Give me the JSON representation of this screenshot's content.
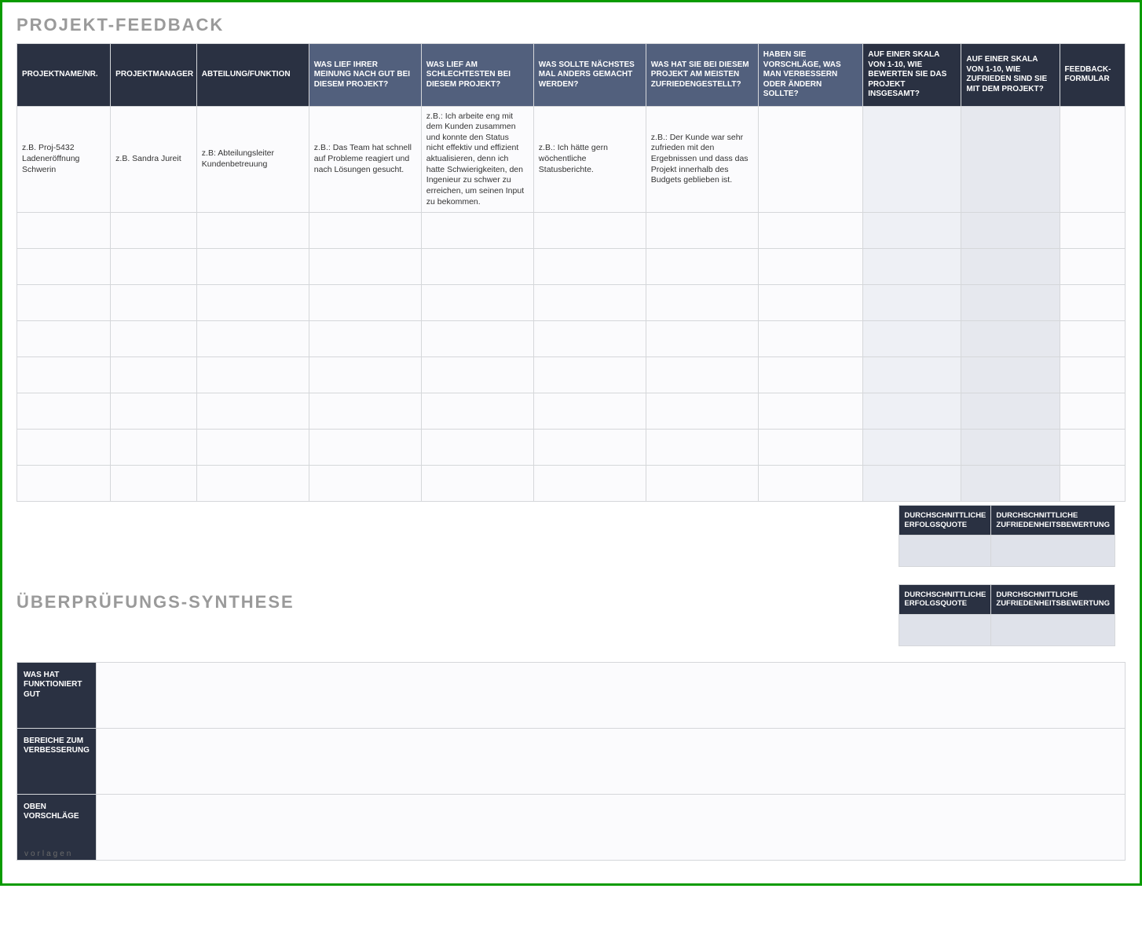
{
  "titles": {
    "feedback": "PROJEKT-FEEDBACK",
    "synthesis": "ÜBERPRÜFUNGS-SYNTHESE"
  },
  "headers": [
    "PROJEKTNAME/NR.",
    "PROJEKTMANAGER",
    "ABTEILUNG/FUNKTION",
    "WAS LIEF IHRER MEINUNG NACH GUT BEI DIESEM PROJEKT?",
    "WAS LIEF AM SCHLECHTESTEN BEI DIESEM PROJEKT?",
    "WAS SOLLTE NÄCHSTES MAL ANDERS GEMACHT WERDEN?",
    "WAS HAT SIE BEI DIESEM PROJEKT AM MEISTEN ZUFRIEDENGESTELLT?",
    "HABEN SIE VORSCHLÄGE, WAS MAN VERBESSERN ODER ÄNDERN SOLLTE?",
    "AUF EINER SKALA VON 1-10, WIE BEWERTEN SIE DAS PROJEKT INSGESAMT?",
    "AUF EINER SKALA VON 1-10, WIE ZUFRIEDEN SIND SIE MIT DEM PROJEKT?",
    "FEEDBACK-FORMULAR"
  ],
  "row0": {
    "c0": "z.B. Proj-5432 Ladeneröffnung Schwerin",
    "c1": "z.B. Sandra Jureit",
    "c2": "z.B: Abteilungsleiter Kundenbetreuung",
    "c3": "z.B.: Das Team hat schnell auf Probleme reagiert und nach Lösungen gesucht.",
    "c4": "z.B.: Ich arbeite eng mit dem Kunden zusammen und konnte den Status nicht effektiv und effizient aktualisieren, denn ich hatte Schwierigkeiten, den Ingenieur zu schwer zu erreichen, um seinen Input zu bekommen.",
    "c5": "z.B.: Ich hätte gern wöchentliche Statusberichte.",
    "c6": "z.B.: Der Kunde war sehr zufrieden mit den Ergebnissen und dass das Projekt innerhalb des Budgets geblieben ist.",
    "c7": "",
    "c8": "",
    "c9": "",
    "c10": ""
  },
  "avg": {
    "success": "DURCHSCHNITTLICHE ERFOLGSQUOTE",
    "satisfaction": "DURCHSCHNITTLICHE ZUFRIEDENHEITSBEWERTUNG"
  },
  "synthesis": {
    "row1": "WAS HAT FUNKTIONIERT GUT",
    "row2": "BEREICHE ZUM VERBESSERUNG",
    "row3": "OBEN VORSCHLÄGE"
  },
  "watermark": "vorlagen"
}
